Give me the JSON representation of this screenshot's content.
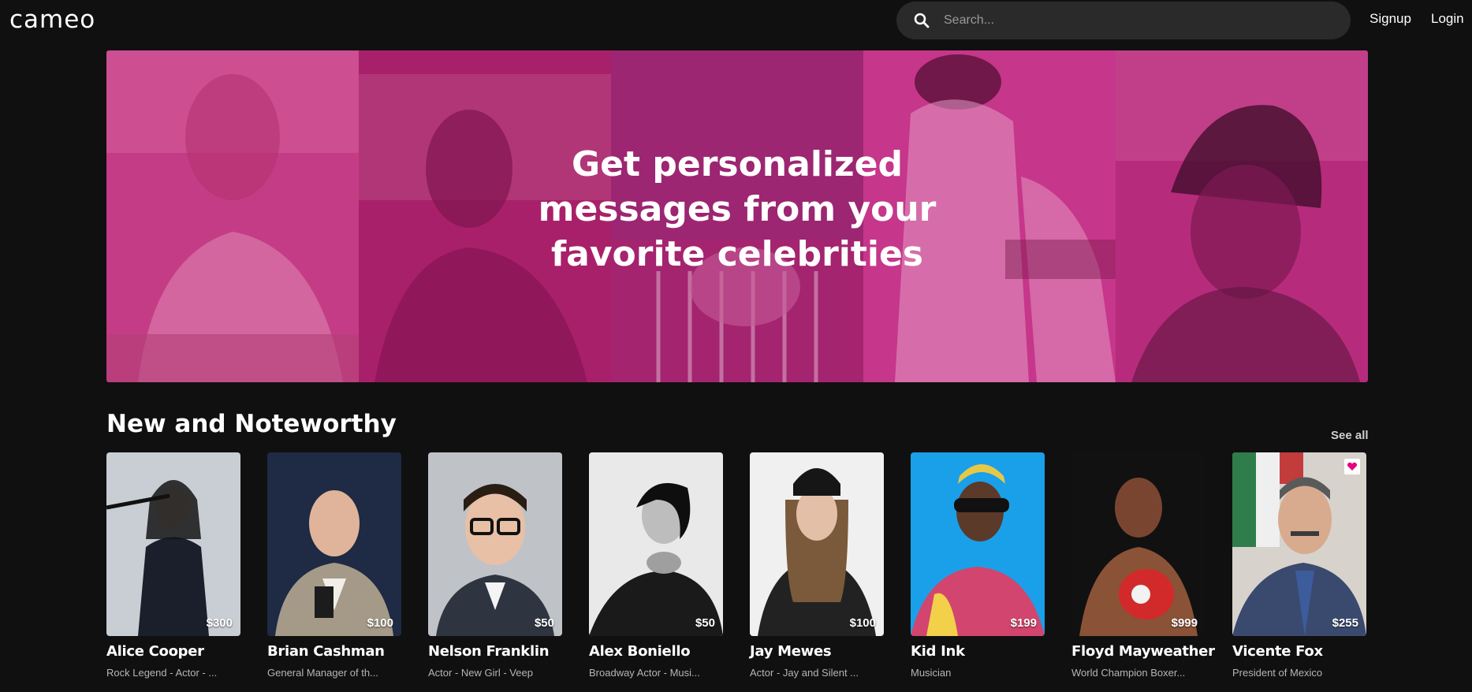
{
  "header": {
    "logo": "cameo",
    "search_placeholder": "Search...",
    "signup": "Signup",
    "login": "Login"
  },
  "hero": {
    "headline": "Get personalized messages from your favorite celebrities",
    "panel_colors": [
      "#c53c86",
      "#a9206a",
      "#a4246f",
      "#c6368a",
      "#b72b7c"
    ]
  },
  "section": {
    "title": "New and Noteworthy",
    "see_all": "See all"
  },
  "celebrities": [
    {
      "name": "Alice Cooper",
      "description": "Rock Legend - Actor - ...",
      "price": "$300",
      "bg": "#c9ced4"
    },
    {
      "name": "Brian Cashman",
      "description": "General Manager of th...",
      "price": "$100",
      "bg": "#1f2a44"
    },
    {
      "name": "Nelson Franklin",
      "description": "Actor - New Girl - Veep",
      "price": "$50",
      "bg": "#bfc3c7"
    },
    {
      "name": "Alex Boniello",
      "description": "Broadway Actor - Musi...",
      "price": "$50",
      "bg": "#e9e9e9"
    },
    {
      "name": "Jay Mewes",
      "description": "Actor - Jay and Silent ...",
      "price": "$100",
      "bg": "#f0f0f0"
    },
    {
      "name": "Kid Ink",
      "description": "Musician",
      "price": "$199",
      "bg": "#1aa0e8"
    },
    {
      "name": "Floyd Mayweather",
      "description": "World Champion Boxer...",
      "price": "$999",
      "bg": "#111111"
    },
    {
      "name": "Vicente Fox",
      "description": "President of Mexico",
      "price": "$255",
      "bg": "#d7d2cc"
    }
  ],
  "colors": {
    "accent_pink": "#e6007e",
    "background": "#101010"
  }
}
